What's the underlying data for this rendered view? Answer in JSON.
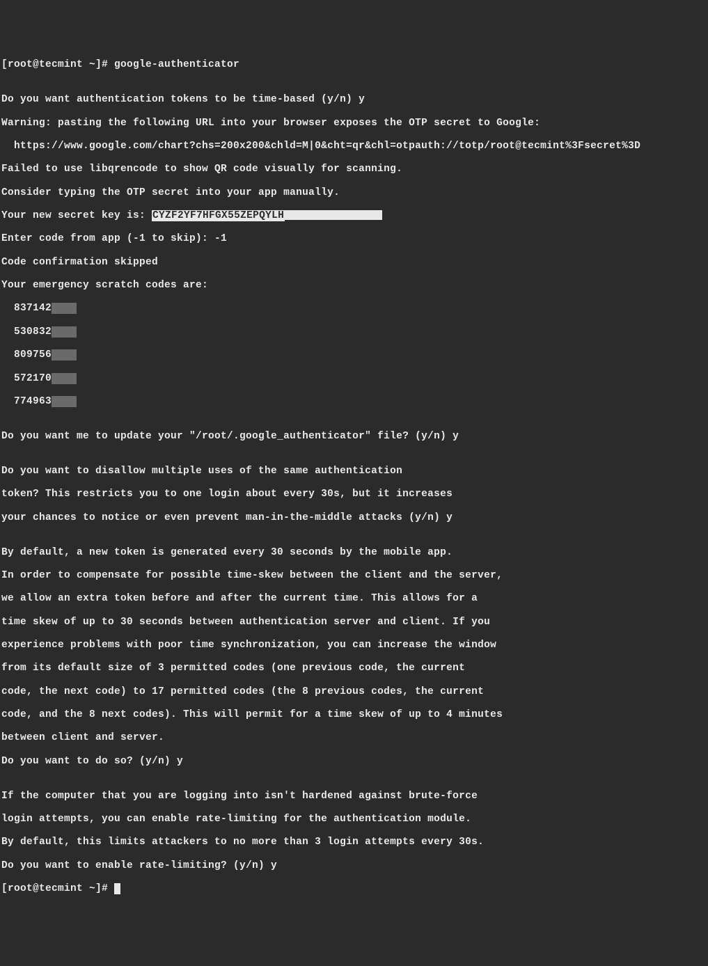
{
  "prompt1": "[root@tecmint ~]# google-authenticator",
  "blank1": "",
  "q1": "Do you want authentication tokens to be time-based (y/n) y",
  "warn": "Warning: pasting the following URL into your browser exposes the OTP secret to Google:",
  "url": "  https://www.google.com/chart?chs=200x200&chld=M|0&cht=qr&chl=otpauth://totp/root@tecmint%3Fsecret%3D",
  "fail": "Failed to use libqrencode to show QR code visually for scanning.",
  "consider": "Consider typing the OTP secret into your app manually.",
  "secret_label": "Your new secret key is: ",
  "secret_highlight": "CYZF2YF7HFGX55ZEPQYLH",
  "enter_code": "Enter code from app (-1 to skip): -1",
  "skipped": "Code confirmation skipped",
  "codes_label": "Your emergency scratch codes are:",
  "code1": "  837142",
  "code2": "  530832",
  "code3": "  809756",
  "code4": "  572170",
  "code5": "  774963",
  "blank2": "",
  "q2": "Do you want me to update your \"/root/.google_authenticator\" file? (y/n) y",
  "blank3": "",
  "q3a": "Do you want to disallow multiple uses of the same authentication",
  "q3b": "token? This restricts you to one login about every 30s, but it increases",
  "q3c": "your chances to notice or even prevent man-in-the-middle attacks (y/n) y",
  "blank4": "",
  "p4a": "By default, a new token is generated every 30 seconds by the mobile app.",
  "p4b": "In order to compensate for possible time-skew between the client and the server,",
  "p4c": "we allow an extra token before and after the current time. This allows for a",
  "p4d": "time skew of up to 30 seconds between authentication server and client. If you",
  "p4e": "experience problems with poor time synchronization, you can increase the window",
  "p4f": "from its default size of 3 permitted codes (one previous code, the current",
  "p4g": "code, the next code) to 17 permitted codes (the 8 previous codes, the current",
  "p4h": "code, and the 8 next codes). This will permit for a time skew of up to 4 minutes",
  "p4i": "between client and server.",
  "p4j": "Do you want to do so? (y/n) y",
  "blank5": "",
  "p5a": "If the computer that you are logging into isn't hardened against brute-force",
  "p5b": "login attempts, you can enable rate-limiting for the authentication module.",
  "p5c": "By default, this limits attackers to no more than 3 login attempts every 30s.",
  "p5d": "Do you want to enable rate-limiting? (y/n) y",
  "prompt2": "[root@tecmint ~]# "
}
